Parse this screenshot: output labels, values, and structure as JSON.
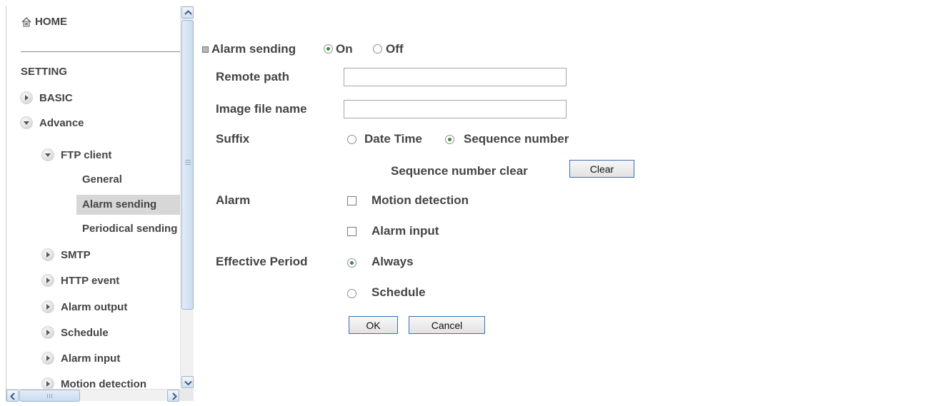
{
  "sidebar": {
    "home_label": "HOME",
    "section_title": "SETTING",
    "items": [
      {
        "label": "BASIC"
      },
      {
        "label": "Advance"
      },
      {
        "label": "FTP client"
      },
      {
        "label": "General"
      },
      {
        "label": "Alarm sending"
      },
      {
        "label": "Periodical sending"
      },
      {
        "label": "SMTP"
      },
      {
        "label": "HTTP event"
      },
      {
        "label": "Alarm output"
      },
      {
        "label": "Schedule"
      },
      {
        "label": "Alarm input"
      },
      {
        "label": "Motion detection"
      }
    ],
    "selected": "Alarm sending"
  },
  "form": {
    "alarm_sending_label": "Alarm sending",
    "alarm_sending_on": "On",
    "alarm_sending_off": "Off",
    "alarm_sending_value": "On",
    "remote_path_label": "Remote path",
    "remote_path_value": "",
    "image_file_name_label": "Image file name",
    "image_file_name_value": "",
    "suffix_label": "Suffix",
    "suffix_date_time": "Date Time",
    "suffix_sequence": "Sequence number",
    "suffix_value": "Sequence number",
    "sequence_clear_label": "Sequence number clear",
    "clear_button": "Clear",
    "alarm_label": "Alarm",
    "alarm_motion_detection": "Motion detection",
    "alarm_input": "Alarm input",
    "effective_period_label": "Effective Period",
    "period_always": "Always",
    "period_schedule": "Schedule",
    "period_value": "Always",
    "ok_button": "OK",
    "cancel_button": "Cancel"
  },
  "icons": {
    "home": "house-icon",
    "collapsed": "arrow-right-icon",
    "expanded": "arrow-down-icon"
  }
}
